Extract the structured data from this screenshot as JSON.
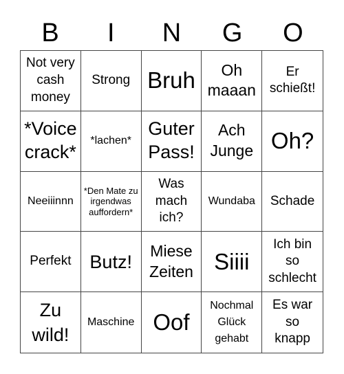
{
  "header": {
    "letters": [
      "B",
      "I",
      "N",
      "G",
      "O"
    ]
  },
  "cells": [
    [
      "Not very cash money",
      "Strong",
      "Bruh",
      "Oh maaan",
      "Er schießt!"
    ],
    [
      "*Voice crack*",
      "*lachen*",
      "Guter Pass!",
      "Ach Junge",
      "Oh?"
    ],
    [
      "Neeiiinnn",
      "*Den Mate zu irgendwas auffordern*",
      "Was mach ich?",
      "Wundaba",
      "Schade"
    ],
    [
      "Perfekt",
      "Butz!",
      "Miese Zeiten",
      "Siiii",
      "Ich bin so schlecht"
    ],
    [
      "Zu wild!",
      "Maschine",
      "Oof",
      "Nochmal Glück gehabt",
      "Es war so knapp"
    ]
  ]
}
